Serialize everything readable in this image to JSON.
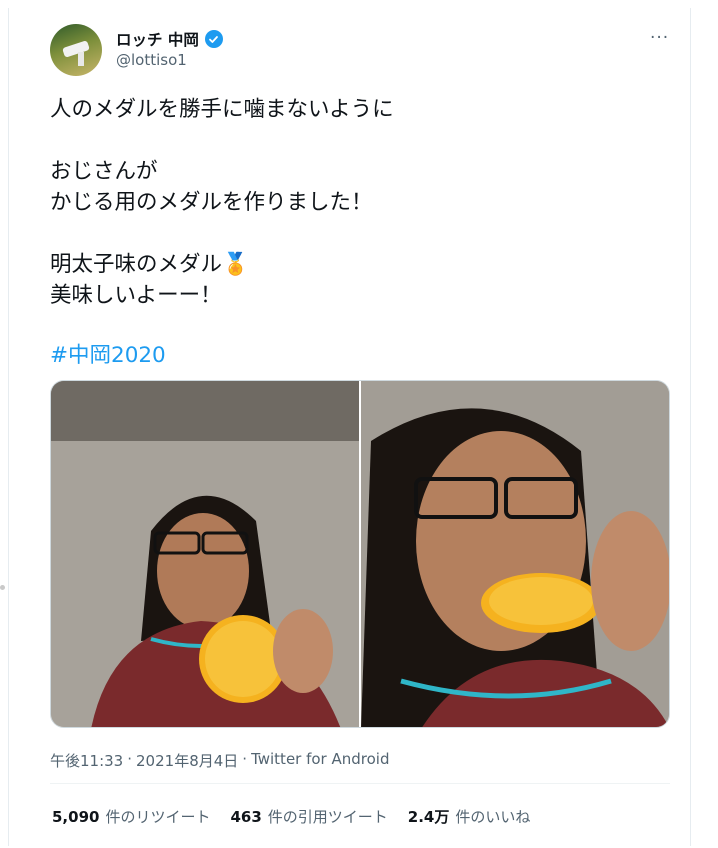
{
  "author": {
    "display_name": "ロッチ 中岡",
    "handle": "@lottiso1",
    "verified_icon": "verified-badge-icon",
    "avatar_icon": "avatar-photo"
  },
  "more_label": "···",
  "tweet": {
    "lines": [
      "人のメダルを勝手に噛まないように",
      "",
      "おじさんが",
      "かじる用のメダルを作りました！",
      "",
      "明太子味のメダル🏅",
      "美味しいよーー！"
    ],
    "hashtag": "#中岡2020"
  },
  "meta": {
    "time": "午後11:33",
    "sep": "·",
    "date": "2021年8月4日",
    "sep2": "·",
    "source": "Twitter for Android"
  },
  "stats": {
    "retweets_count": "5,090",
    "retweets_label": "件のリツイート",
    "quotes_count": "463",
    "quotes_label": "件の引用ツイート",
    "likes_count": "2.4万",
    "likes_label": "件のいいね"
  },
  "colors": {
    "accent": "#1d9bf0",
    "text": "#0f1419",
    "secondary": "#536471"
  }
}
